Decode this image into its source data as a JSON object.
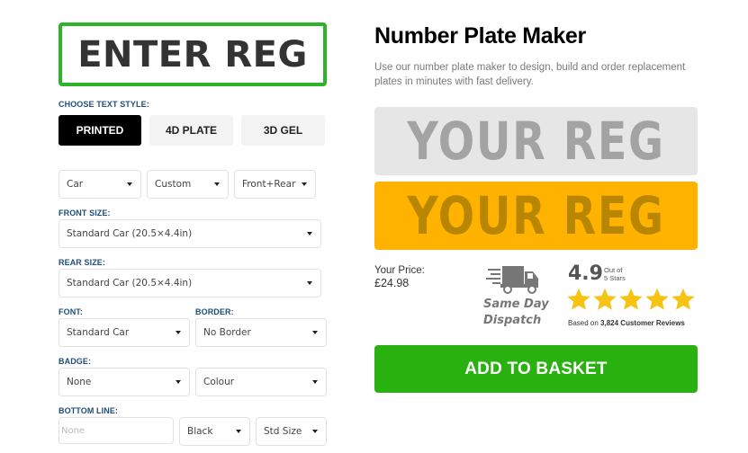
{
  "reg_input": {
    "placeholder": "ENTER REG"
  },
  "text_style": {
    "label": "CHOOSE TEXT STYLE:",
    "options": [
      {
        "label": "PRINTED",
        "active": true
      },
      {
        "label": "4D PLATE",
        "active": false
      },
      {
        "label": "3D GEL",
        "active": false
      }
    ]
  },
  "vehicle_selects": {
    "vehicle_type": "Car",
    "plate_type": "Custom",
    "plates": "Front+Rear"
  },
  "front_size": {
    "label": "FRONT SIZE:",
    "value": "Standard Car (20.5×4.4in)"
  },
  "rear_size": {
    "label": "REAR SIZE:",
    "value": "Standard Car (20.5×4.4in)"
  },
  "font": {
    "label": "FONT:",
    "value": "Standard Car"
  },
  "border": {
    "label": "BORDER:",
    "value": "No Border"
  },
  "badge": {
    "label": "BADGE:",
    "value": "None",
    "colour": "Colour"
  },
  "bottom_line": {
    "label": "BOTTOM LINE:",
    "placeholder": "None",
    "colour": "Black",
    "size": "Std Size"
  },
  "header": {
    "title": "Number Plate Maker",
    "description": "Use our number plate maker to design, build and order replacement plates in minutes with fast delivery."
  },
  "preview": {
    "front_text": "YOUR REG",
    "rear_text": "YOUR REG",
    "front_color": "#e6e6e6",
    "rear_color": "#ffb300"
  },
  "price": {
    "label": "Your Price:",
    "value": "£24.98"
  },
  "dispatch": {
    "icon": "delivery-truck-icon",
    "line1": "Same Day",
    "line2": "Dispatch"
  },
  "rating": {
    "score": "4.9",
    "out_of_line1": "Out of",
    "out_of_line2": "5 Stars",
    "stars": 5,
    "reviews_prefix": "Based on",
    "reviews_count": "3,824 Customer Reviews"
  },
  "cta": {
    "label": "ADD TO BASKET",
    "color": "#28b10f"
  },
  "colors": {
    "accent_green": "#2db42a",
    "label_blue": "#1e4e79",
    "star_gold": "#f7c313"
  }
}
